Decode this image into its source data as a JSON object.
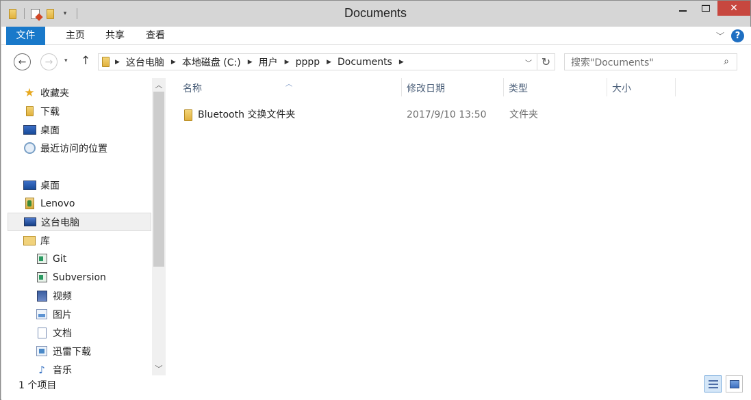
{
  "window": {
    "title": "Documents"
  },
  "ribbon": {
    "tabs": [
      "文件",
      "主页",
      "共享",
      "查看"
    ]
  },
  "address": {
    "crumbs": [
      "这台电脑",
      "本地磁盘 (C:)",
      "用户",
      "pppp",
      "Documents"
    ],
    "search_placeholder": "搜索\"Documents\""
  },
  "nav": {
    "favorites": "收藏夹",
    "downloads": "下载",
    "desktop_fav": "桌面",
    "recent": "最近访问的位置",
    "desktop": "桌面",
    "lenovo": "Lenovo",
    "this_pc": "这台电脑",
    "library": "库",
    "git": "Git",
    "subversion": "Subversion",
    "videos": "视频",
    "pictures": "图片",
    "docs": "文档",
    "xunlei": "迅雷下载",
    "music": "音乐"
  },
  "columns": {
    "name": "名称",
    "modified": "修改日期",
    "type": "类型",
    "size": "大小"
  },
  "files": [
    {
      "name": "Bluetooth 交换文件夹",
      "modified": "2017/9/10 13:50",
      "type": "文件夹"
    }
  ],
  "status": {
    "count": "1 个项目"
  },
  "colors": {
    "file_tab": "#1979ca",
    "close_button": "#c7473f",
    "header_text": "#4c607a"
  }
}
